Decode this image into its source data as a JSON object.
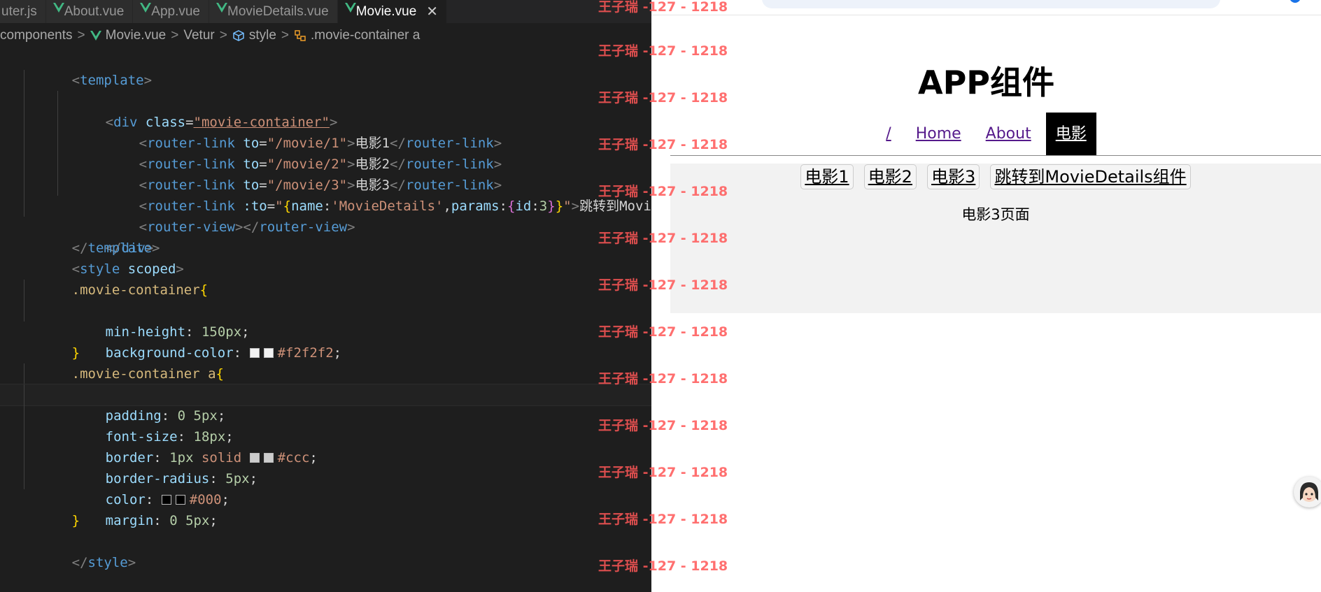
{
  "editor": {
    "tabs": [
      {
        "label": "uter.js",
        "vue": false,
        "active": false
      },
      {
        "label": "About.vue",
        "vue": true,
        "active": false
      },
      {
        "label": "App.vue",
        "vue": true,
        "active": false
      },
      {
        "label": "MovieDetails.vue",
        "vue": true,
        "active": false
      },
      {
        "label": "Movie.vue",
        "vue": true,
        "active": true,
        "close": "✕"
      }
    ],
    "breadcrumb": {
      "folder": "components",
      "file": "Movie.vue",
      "lang": "Vetur",
      "section": "style",
      "selector": ".movie-container a",
      "sep": ">"
    },
    "code": {
      "l1": {
        "open": "<",
        "tag": "template",
        "close": ">"
      },
      "l2": {
        "open": "<",
        "tag": "div",
        "attr": "class",
        "eq": "=",
        "value": "\"movie-container\"",
        "close": ">"
      },
      "l3": {
        "open": "<",
        "tag": "router-link",
        "attr": "to",
        "eq": "=",
        "value": "\"/movie/1\"",
        "mid": ">",
        "text": "电影1",
        "endopen": "</",
        "endtag": "router-link",
        "endclose": ">"
      },
      "l4": {
        "open": "<",
        "tag": "router-link",
        "attr": "to",
        "eq": "=",
        "value": "\"/movie/2\"",
        "mid": ">",
        "text": "电影2",
        "endopen": "</",
        "endtag": "router-link",
        "endclose": ">"
      },
      "l5": {
        "open": "<",
        "tag": "router-link",
        "attr": "to",
        "eq": "=",
        "value": "\"/movie/3\"",
        "mid": ">",
        "text": "电影3",
        "endopen": "</",
        "endtag": "router-link",
        "endclose": ">"
      },
      "l6": {
        "open": "<",
        "tag": "router-link",
        "attr": ":to",
        "eq": "=",
        "q1": "\"",
        "b1": "{",
        "k1": "name",
        "c1": ":",
        "v1": "'MovieDetails'",
        "comma": ",",
        "k2": "params",
        "c2": ":",
        "b2": "{",
        "k3": "id",
        "c3": ":",
        "v3": "3",
        "b2c": "}",
        "b1c": "}",
        "q2": "\"",
        "mid": ">",
        "text": "跳转到MovieDe"
      },
      "l7": {
        "open": "<",
        "tag": "router-view",
        "mid": "></",
        "endtag": "router-view",
        "close": ">"
      },
      "l8": {
        "open": "</",
        "tag": "div",
        "close": ">"
      },
      "l9": {
        "open": "</",
        "tag": "template",
        "close": ">"
      },
      "l10": {
        "open": "<",
        "tag": "style",
        "attr": "scoped",
        "close": ">"
      },
      "l11": {
        "selector": ".movie-container",
        "brace": "{"
      },
      "l12": {
        "prop": "min-height",
        "colon": ":",
        "value": "150px",
        "semi": ";"
      },
      "l13": {
        "prop": "background-color",
        "colon": ":",
        "value": "#f2f2f2",
        "semi": ";"
      },
      "l14": {
        "brace": "}"
      },
      "l15": {
        "selector": ".movie-container a",
        "brace": "{"
      },
      "l16": {
        "prop": "padding",
        "colon": ":",
        "value": "0 5px",
        "semi": ";"
      },
      "l17": {
        "prop": "font-size",
        "colon": ":",
        "value": "18px",
        "semi": ";"
      },
      "l18": {
        "prop": "border",
        "colon": ":",
        "value1": "1px",
        "value2": "solid",
        "value": "#ccc",
        "semi": ";"
      },
      "l19": {
        "prop": "border-radius",
        "colon": ":",
        "value": "5px",
        "semi": ";"
      },
      "l20": {
        "prop": "color",
        "colon": ":",
        "value": "#000",
        "semi": ";"
      },
      "l21": {
        "prop": "margin",
        "colon": ":",
        "value": "0 5px",
        "semi": ";"
      },
      "l22": {
        "brace": "}"
      },
      "l24": {
        "open": "</",
        "tag": "style",
        "close": ">"
      }
    },
    "swatch_colors": {
      "bg": "#f2f2f2",
      "border": "#cccccc",
      "text": "#000000"
    }
  },
  "watermark": {
    "text": "王子瑞 -127 - 1218"
  },
  "browser": {
    "app_title": "APP组件",
    "nav": [
      {
        "label": "/",
        "active": false
      },
      {
        "label": "Home",
        "active": false
      },
      {
        "label": "About",
        "active": false
      },
      {
        "label": "电影",
        "active": true
      }
    ],
    "movie_links": [
      "电影1",
      "电影2",
      "电影3",
      "跳转到MovieDetails组件"
    ],
    "movie_view": "电影3页面"
  },
  "colors": {
    "editor_bg": "#1e1e1e",
    "vue_green": "#41b883",
    "active_nav": "#000000",
    "visited_link": "#551a8b",
    "watermark": "#ff5757"
  }
}
